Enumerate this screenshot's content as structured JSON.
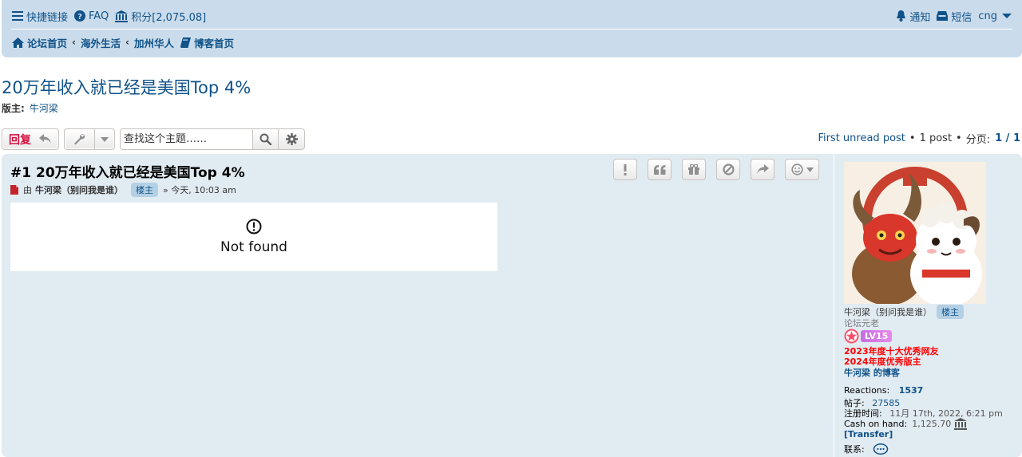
{
  "nav": {
    "quicklinks": "快捷链接",
    "faq": "FAQ",
    "points": "积分[2,075.08]",
    "notifications": "通知",
    "messages": "短信",
    "username": "cng"
  },
  "breadcrumbs": [
    "论坛首页",
    "海外生活",
    "加州华人",
    "博客首页"
  ],
  "topic": {
    "title": "20万年收入就已经是美国Top 4%",
    "moderator_label": "版主:",
    "moderator_name": "牛河梁"
  },
  "actionbar": {
    "reply_label": "回复",
    "search_placeholder": "查找这个主题……"
  },
  "pagination": {
    "first_unread": "First unread post",
    "post_count": "1 post",
    "page_label": "分页:",
    "pages": "1 / 1"
  },
  "post": {
    "title": "#1 20万年收入就已经是美国Top 4%",
    "by": "由",
    "author": "牛河梁（别问我是谁）",
    "author_badge": "楼主",
    "timestamp": "» 今天, 10:03 am",
    "body_message": "Not found"
  },
  "profile": {
    "name": "牛河梁（别问我是谁）",
    "badge": "楼主",
    "rank": "论坛元老",
    "level": "LV15",
    "honor1": "2023年度十大优秀网友",
    "honor2": "2024年度优秀版主",
    "blog": "牛河梁 的博客",
    "reactions_label": "Reactions:",
    "reactions_value": "1537",
    "posts_label": "帖子:",
    "posts_value": "27585",
    "joined_label": "注册时间:",
    "joined_value": "11月 17th, 2022, 6:21 pm",
    "cash_label": "Cash on hand:",
    "cash_value": "1,125.70",
    "transfer": "[Transfer]",
    "contact_label": "联系:"
  }
}
